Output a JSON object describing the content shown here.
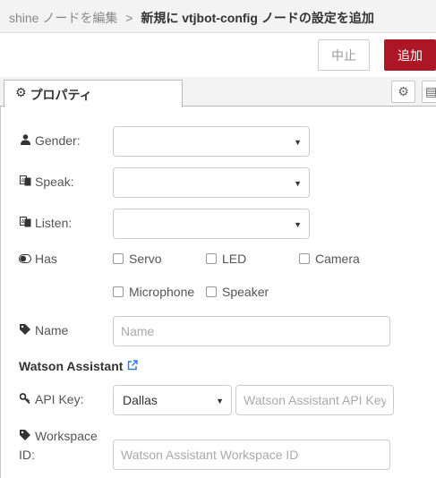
{
  "breadcrumb": {
    "parent": "shine ノードを編集",
    "separator": ">",
    "current": "新規に vtjbot-config ノードの設定を追加"
  },
  "buttons": {
    "cancel": "中止",
    "add": "追加"
  },
  "tabs": {
    "properties": "プロパティ"
  },
  "form": {
    "gender_label": "Gender:",
    "speak_label": "Speak:",
    "listen_label": "Listen:",
    "gender_value": "",
    "speak_value": "",
    "listen_value": "",
    "has_label": "Has",
    "has_options": [
      "Servo",
      "LED",
      "Camera",
      "Microphone",
      "Speaker"
    ],
    "name_label": "Name",
    "name_placeholder": "Name",
    "section_title": "Watson Assistant",
    "apikey_label": "API Key:",
    "region_value": "Dallas",
    "apikey_placeholder": "Watson Assistant API Key",
    "workspace_label_line1": "Workspace",
    "workspace_label_line2": "ID:",
    "workspace_placeholder": "Watson Assistant Workspace ID"
  },
  "colors": {
    "primary_button": "#ad1625",
    "link_icon": "#2d7dd2"
  },
  "icons": {
    "gender": "user-icon",
    "speak": "language-icon",
    "listen": "language-icon",
    "has": "toggle-icon",
    "name": "tag-icon",
    "apikey": "key-icon",
    "workspace": "tag-icon",
    "section": "external-link-icon",
    "tab": "gear-icon"
  }
}
